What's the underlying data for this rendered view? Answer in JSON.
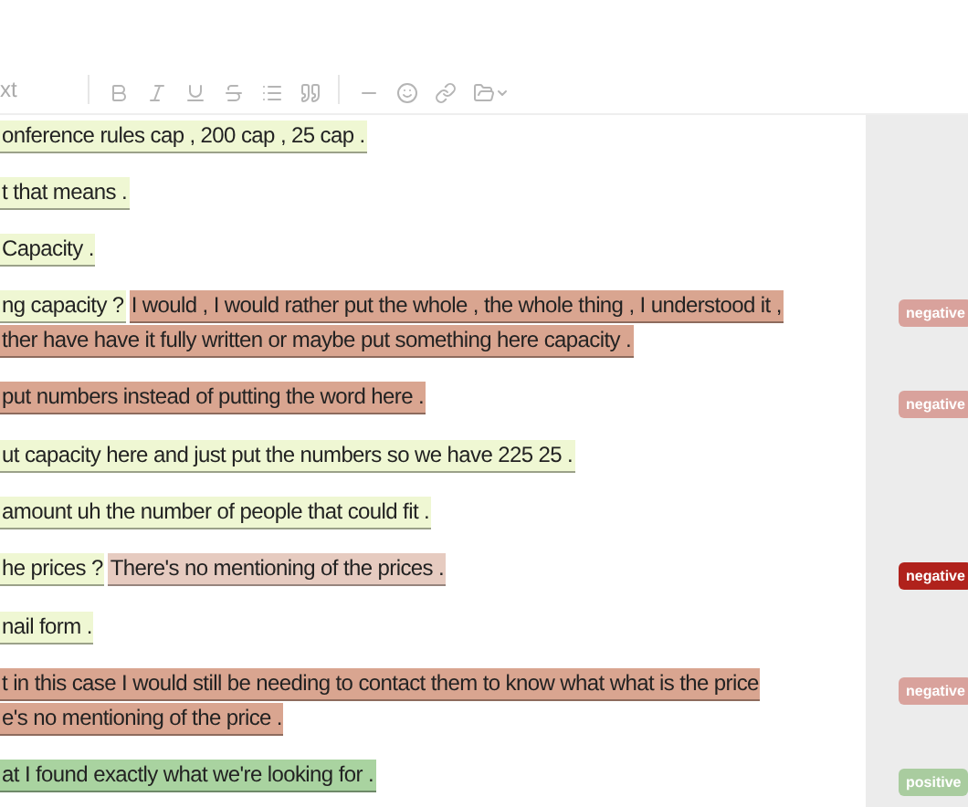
{
  "toolbar": {
    "style_label": "xt"
  },
  "paragraphs": [
    {
      "lines": [
        [
          {
            "text": "onference rules cap , 200 cap , 25 cap .",
            "color": "#eff7d3"
          }
        ]
      ]
    },
    {
      "lines": [
        [
          {
            "text": "t that means .",
            "color": "#eff7d3"
          }
        ]
      ]
    },
    {
      "lines": [
        [
          {
            "text": "Capacity .",
            "color": "#eff7d3"
          }
        ]
      ]
    },
    {
      "lines": [
        [
          {
            "text": "ng capacity ?",
            "color": "#eff7d3"
          },
          {
            "text": "I would , I would rather put the whole , the whole thing , I understood it ,",
            "color": "#d9a590"
          }
        ],
        [
          {
            "text": "ther have have it fully written or maybe put something here capacity .",
            "color": "#d9a590"
          }
        ]
      ],
      "tag": {
        "label": "negative",
        "color": "#d9a29c"
      }
    },
    {
      "lines": [
        [
          {
            "text": "put numbers instead of putting the word here .",
            "color": "#d9a590"
          }
        ]
      ],
      "tag": {
        "label": "negative",
        "color": "#d9a29c"
      }
    },
    {
      "lines": [
        [
          {
            "text": "ut capacity here and just put the numbers so we have 225 25 .",
            "color": "#eff7d3"
          }
        ]
      ]
    },
    {
      "lines": [
        [
          {
            "text": "amount uh the number of people that could fit .",
            "color": "#eff7d3"
          }
        ]
      ]
    },
    {
      "lines": [
        [
          {
            "text": "he prices ?",
            "color": "#eff7d3"
          },
          {
            "text": "There's no mentioning of the prices .",
            "color": "#e6cbc0"
          }
        ]
      ],
      "tag": {
        "label": "negative",
        "color": "#b0221c"
      }
    },
    {
      "lines": [
        [
          {
            "text": "nail form .",
            "color": "#eff7d3"
          }
        ]
      ]
    },
    {
      "lines": [
        [
          {
            "text": "t in this case I would still be needing to contact them to know what what is the price",
            "color": "#d9a590"
          }
        ],
        [
          {
            "text": "e's no mentioning of the price .",
            "color": "#d9a590"
          }
        ]
      ],
      "tag": {
        "label": "negative",
        "color": "#d9a29c"
      }
    },
    {
      "lines": [
        [
          {
            "text": "at I found exactly what we're looking for .",
            "color": "#a9d3a0"
          }
        ]
      ],
      "tag": {
        "label": "positive",
        "color": "#a9cc9f"
      }
    }
  ]
}
